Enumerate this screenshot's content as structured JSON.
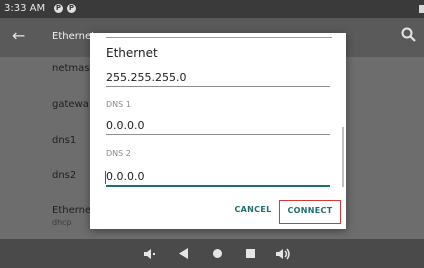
{
  "status": {
    "time": "3:33 AM"
  },
  "appbar": {
    "title": "Ethernet"
  },
  "list": [
    {
      "label": "netmas"
    },
    {
      "label": "gatewa"
    },
    {
      "label": "dns1"
    },
    {
      "label": "dns2"
    },
    {
      "label": "Etherne",
      "sub": "dhcp"
    }
  ],
  "dialog": {
    "title": "Ethernet",
    "netmask_value": "255.255.255.0",
    "dns1_label": "DNS 1",
    "dns1_value": "0.0.0.0",
    "dns2_label": "DNS 2",
    "dns2_value": "0.0.0.0",
    "cancel_label": "CANCEL",
    "connect_label": "CONNECT"
  },
  "colors": {
    "accent": "#1f6f6f",
    "highlight_border": "#d23a3a"
  },
  "icons": [
    "back-arrow-icon",
    "search-icon",
    "volume-down-icon",
    "back-nav-icon",
    "home-icon",
    "recents-icon",
    "volume-up-icon"
  ]
}
